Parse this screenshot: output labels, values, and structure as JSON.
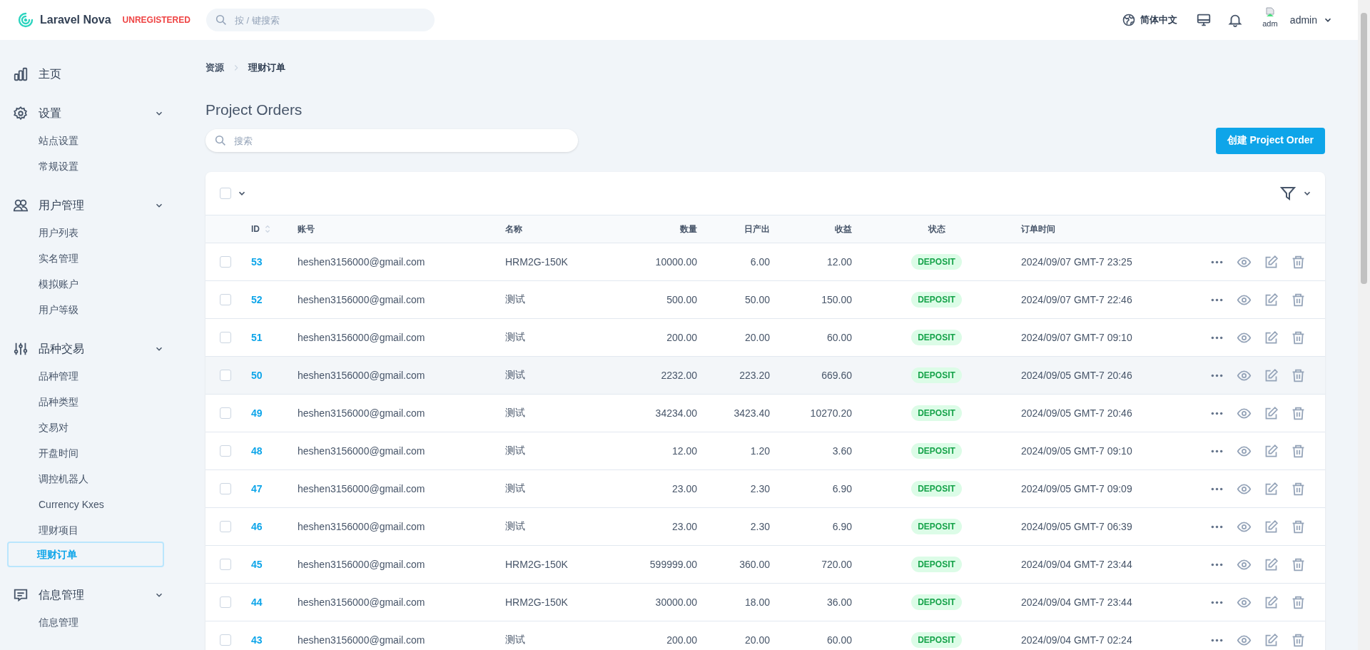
{
  "header": {
    "logo": "Laravel Nova",
    "badge": "UNREGISTERED",
    "search": {
      "placeholder": "按 / 键搜索"
    },
    "language": "简体中文",
    "avatar_alt": "adm",
    "user": "admin"
  },
  "sidebar": {
    "home": {
      "label": "主页"
    },
    "groups": [
      {
        "kind": "settings",
        "label": "设置",
        "expanded": true,
        "items": [
          {
            "label": "站点设置",
            "selected": false
          },
          {
            "label": "常规设置",
            "selected": false
          }
        ]
      },
      {
        "kind": "users",
        "label": "用户管理",
        "expanded": true,
        "items": [
          {
            "label": "用户列表",
            "selected": false
          },
          {
            "label": "实名管理",
            "selected": false
          },
          {
            "label": "模拟账户",
            "selected": false
          },
          {
            "label": "用户等级",
            "selected": false
          }
        ]
      },
      {
        "kind": "sliders",
        "label": "品种交易",
        "expanded": true,
        "items": [
          {
            "label": "品种管理",
            "selected": false
          },
          {
            "label": "品种类型",
            "selected": false
          },
          {
            "label": "交易对",
            "selected": false
          },
          {
            "label": "开盘时间",
            "selected": false
          },
          {
            "label": "调控机器人",
            "selected": false
          },
          {
            "label": "Currency Kxes",
            "selected": false
          },
          {
            "label": "理财项目",
            "selected": false
          },
          {
            "label": "理财订单",
            "selected": true
          }
        ]
      },
      {
        "kind": "messages",
        "label": "信息管理",
        "expanded": true,
        "items": [
          {
            "label": "信息管理",
            "selected": false
          }
        ]
      }
    ]
  },
  "breadcrumb": [
    "资源",
    "理财订单"
  ],
  "title": "Project Orders",
  "search": {
    "placeholder": "搜索"
  },
  "create_button": "创建 Project Order",
  "table": {
    "select_all": {
      "checked": false
    },
    "columns": [
      {
        "label": "ID",
        "kind": "id",
        "sortable": true
      },
      {
        "label": "账号",
        "kind": "text",
        "sortable": false
      },
      {
        "label": "名称",
        "kind": "text",
        "sortable": false
      },
      {
        "label": "数量",
        "kind": "number",
        "sortable": false
      },
      {
        "label": "日产出",
        "kind": "number",
        "sortable": false
      },
      {
        "label": "收益",
        "kind": "number",
        "sortable": false
      },
      {
        "label": "状态",
        "kind": "status",
        "sortable": false
      },
      {
        "label": "订单时间",
        "kind": "time",
        "sortable": false
      }
    ],
    "rows": [
      {
        "selected": false,
        "hovered": false,
        "cells": [
          "53",
          "heshen3156000@gmail.com",
          "HRM2G-150K",
          "10000.00",
          "6.00",
          "12.00",
          "DEPOSIT",
          "2024/09/07 GMT-7 23:25"
        ]
      },
      {
        "selected": false,
        "hovered": false,
        "cells": [
          "52",
          "heshen3156000@gmail.com",
          "测试",
          "500.00",
          "50.00",
          "150.00",
          "DEPOSIT",
          "2024/09/07 GMT-7 22:46"
        ]
      },
      {
        "selected": false,
        "hovered": false,
        "cells": [
          "51",
          "heshen3156000@gmail.com",
          "测试",
          "200.00",
          "20.00",
          "60.00",
          "DEPOSIT",
          "2024/09/07 GMT-7 09:10"
        ]
      },
      {
        "selected": false,
        "hovered": true,
        "cells": [
          "50",
          "heshen3156000@gmail.com",
          "测试",
          "2232.00",
          "223.20",
          "669.60",
          "DEPOSIT",
          "2024/09/05 GMT-7 20:46"
        ]
      },
      {
        "selected": false,
        "hovered": false,
        "cells": [
          "49",
          "heshen3156000@gmail.com",
          "测试",
          "34234.00",
          "3423.40",
          "10270.20",
          "DEPOSIT",
          "2024/09/05 GMT-7 20:46"
        ]
      },
      {
        "selected": false,
        "hovered": false,
        "cells": [
          "48",
          "heshen3156000@gmail.com",
          "测试",
          "12.00",
          "1.20",
          "3.60",
          "DEPOSIT",
          "2024/09/05 GMT-7 09:10"
        ]
      },
      {
        "selected": false,
        "hovered": false,
        "cells": [
          "47",
          "heshen3156000@gmail.com",
          "测试",
          "23.00",
          "2.30",
          "6.90",
          "DEPOSIT",
          "2024/09/05 GMT-7 09:09"
        ]
      },
      {
        "selected": false,
        "hovered": false,
        "cells": [
          "46",
          "heshen3156000@gmail.com",
          "测试",
          "23.00",
          "2.30",
          "6.90",
          "DEPOSIT",
          "2024/09/05 GMT-7 06:39"
        ]
      },
      {
        "selected": false,
        "hovered": false,
        "cells": [
          "45",
          "heshen3156000@gmail.com",
          "HRM2G-150K",
          "599999.00",
          "360.00",
          "720.00",
          "DEPOSIT",
          "2024/09/04 GMT-7 23:44"
        ]
      },
      {
        "selected": false,
        "hovered": false,
        "cells": [
          "44",
          "heshen3156000@gmail.com",
          "HRM2G-150K",
          "30000.00",
          "18.00",
          "36.00",
          "DEPOSIT",
          "2024/09/04 GMT-7 23:44"
        ]
      },
      {
        "selected": false,
        "hovered": false,
        "cells": [
          "43",
          "heshen3156000@gmail.com",
          "测试",
          "200.00",
          "20.00",
          "60.00",
          "DEPOSIT",
          "2024/09/04 GMT-7 02:24"
        ]
      }
    ]
  }
}
